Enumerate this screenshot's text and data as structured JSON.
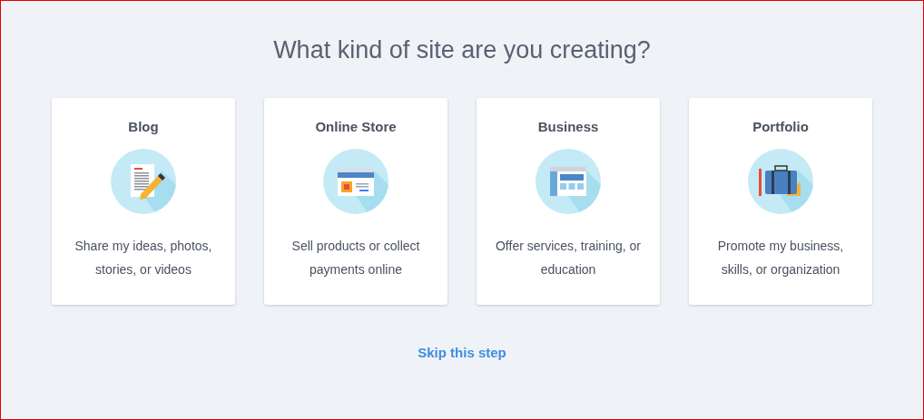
{
  "heading": "What kind of site are you creating?",
  "cards": [
    {
      "kind": "blog",
      "title": "Blog",
      "description": "Share my ideas, photos, stories, or videos"
    },
    {
      "kind": "store",
      "title": "Online Store",
      "description": "Sell products or collect payments online"
    },
    {
      "kind": "business",
      "title": "Business",
      "description": "Offer services, training, or education"
    },
    {
      "kind": "portfolio",
      "title": "Portfolio",
      "description": "Promote my business, skills, or organization"
    }
  ],
  "skip_link": "Skip this step"
}
